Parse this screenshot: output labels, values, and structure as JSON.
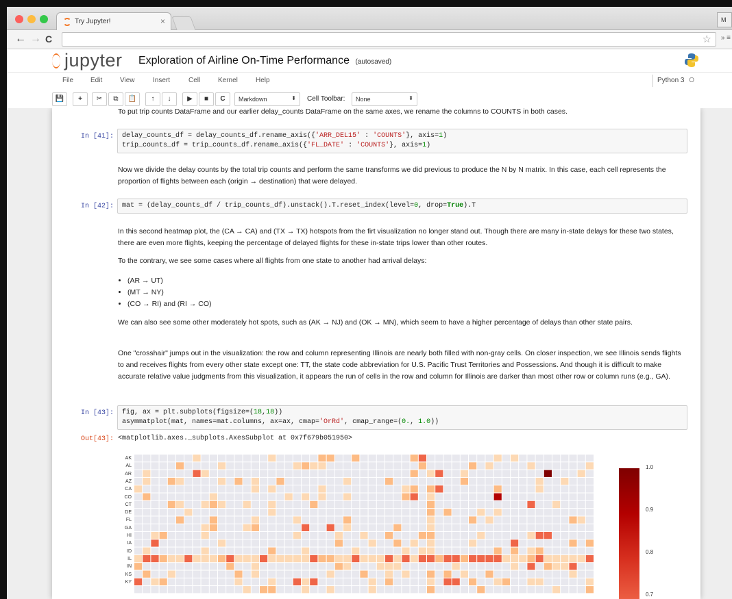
{
  "browser": {
    "tab_title": "Try Jupyter!",
    "tab_close": "×",
    "right_button": "M",
    "back": "←",
    "forward": "→",
    "reload": "C",
    "star": "☆",
    "extra": "» ≡"
  },
  "header": {
    "logo_text": "jupyter",
    "notebook_title": "Exploration of Airline On-Time Performance",
    "save_status": "(autosaved)"
  },
  "menu": {
    "items": [
      "File",
      "Edit",
      "View",
      "Insert",
      "Cell",
      "Kernel",
      "Help"
    ],
    "kernel": "Python 3",
    "kernel_status": "O"
  },
  "toolbar": {
    "buttons": [
      "💾",
      "+",
      "✂",
      "⧉",
      "📋",
      "↑",
      "↓",
      "▶",
      "■",
      "C"
    ],
    "cell_type": "Markdown",
    "cell_toolbar_label": "Cell Toolbar:",
    "cell_toolbar_value": "None"
  },
  "cells": {
    "md0": "To put trip counts DataFrame and our earlier delay_counts DataFrame on the same axes, we rename the columns to COUNTS in both cases.",
    "c41_prompt": "In [41]:",
    "c41_line1_a": "delay_counts_df = delay_counts_df.rename_axis({",
    "c41_line1_s1": "'ARR_DEL15'",
    "c41_line1_b": " : ",
    "c41_line1_s2": "'COUNTS'",
    "c41_line1_c": "}, axis=",
    "c41_line1_n": "1",
    "c41_line1_d": ")",
    "c41_line2_a": "trip_counts_df = trip_counts_df.rename_axis({",
    "c41_line2_s1": "'FL_DATE'",
    "c41_line2_b": " : ",
    "c41_line2_s2": "'COUNTS'",
    "c41_line2_c": "}, axis=",
    "c41_line2_n": "1",
    "c41_line2_d": ")",
    "md1": "Now we divide the delay counts by the total trip counts and perform the same transforms we did previous to produce the N by N matrix. In this case, each cell represents the proportion of flights between each (origin → destination) that were delayed.",
    "c42_prompt": "In [42]:",
    "c42_a": "mat = (delay_counts_df / trip_counts_df).unstack().T.reset_index(level=",
    "c42_n": "0",
    "c42_b": ", drop=",
    "c42_kw": "True",
    "c42_c": ").T",
    "md2": "In this second heatmap plot, the (CA → CA) and (TX → TX) hotspots from the firt visualization no longer stand out. Though there are many in-state delays for these two states, there are even more flights, keeping the percentage of delayed flights for these in-state trips lower than other routes.",
    "md3": "To the contrary, we see some cases where all flights from one state to another had arrival delays:",
    "bullets": [
      "(AR → UT)",
      "(MT → NY)",
      "(CO → RI) and (RI → CO)"
    ],
    "md4": "We can also see some other moderately hot spots, such as (AK → NJ) and (OK → MN), which seem to have a higher percentage of delays than other state pairs.",
    "md5": "One \"crosshair\" jumps out in the visualization: the row and column representing Illinois are nearly both filled with non-gray cells. On closer inspection, we see Illinois sends flights to and receives flights from every other state except one: TT, the state code abbreviation for U.S. Pacific Trust Territories and Possessions. And though it is difficult to make accurate relative value judgments from this visualization, it appears the run of cells in the row and column for Illinois are darker than most other row or column runs (e.g., GA).",
    "c43_prompt": "In [43]:",
    "c43_l1a": "fig, ax = plt.subplots(figsize=(",
    "c43_l1n1": "18",
    "c43_l1b": ",",
    "c43_l1n2": "18",
    "c43_l1c": "))",
    "c43_l2a": "asymmatplot(mat, names=mat.columns, ax=ax, cmap=",
    "c43_l2s": "'OrRd'",
    "c43_l2b": ", cmap_range=(",
    "c43_l2n1": "0.",
    "c43_l2c": ", ",
    "c43_l2n2": "1.0",
    "c43_l2d": "))",
    "out43_prompt": "Out[43]:",
    "out43_text": "<matplotlib.axes._subplots.AxesSubplot at 0x7f679b051950>"
  },
  "heatmap": {
    "row_labels": [
      "AK",
      "AL",
      "AR",
      "AZ",
      "CA",
      "CO",
      "CT",
      "DE",
      "FL",
      "GA",
      "HI",
      "IA",
      "ID",
      "IL",
      "IN",
      "KS",
      "KY"
    ],
    "colorbar_ticks": [
      "1.0",
      "0.9",
      "0.8",
      "0.7"
    ],
    "colors": {
      "empty": "#e8e8ee",
      "light": "#fdd9b4",
      "mid": "#fdbb84",
      "hot": "#ef6548",
      "dark": "#b30000",
      "darkest": "#7f0000"
    }
  }
}
